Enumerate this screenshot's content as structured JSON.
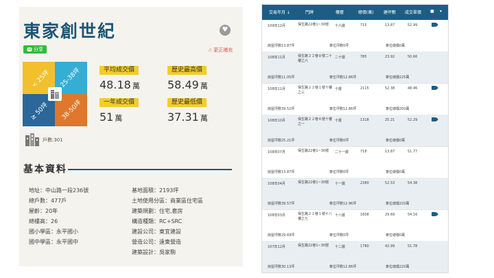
{
  "left": {
    "title": "東家創世紀",
    "favorite_icon": "heart-icon",
    "share_label": "分享",
    "share_icon_text": "LINE",
    "report_label": "更正補充",
    "area_grid": {
      "q1": "< 25坪",
      "q2": "25-38坪",
      "q3": "≥ 50坪",
      "q4": "38-50坪",
      "colors": {
        "q1": "#f2c02c",
        "q2": "#35aed6",
        "q3": "#2b6799",
        "q4": "#e0772a"
      }
    },
    "households": "戶數:301",
    "prices": [
      {
        "label": "平均成交價",
        "value": "48.18",
        "unit": "萬"
      },
      {
        "label": "歷史最高價",
        "value": "58.49",
        "unit": "萬"
      },
      {
        "label": "一年成交價",
        "value": "51",
        "unit": "萬"
      },
      {
        "label": "歷史最低價",
        "value": "37.31",
        "unit": "萬"
      }
    ],
    "basic_title": "基本資料",
    "info_left": [
      "地址：中山路一段236號",
      "總戶數：477戶",
      "屋齡：20年",
      "總樓高：26",
      "國小學區：永平國小",
      "國中學區：永平國中"
    ],
    "info_right": [
      "基地面積：2193坪",
      "土地使用分區：商業區住宅區",
      "建築規劃：住宅,套房",
      "構造種類：RC+SRC",
      "建設公司：東宜建設",
      "營造公司：遠東營造",
      "建築設計：吳家駒"
    ]
  },
  "table": {
    "headers": [
      "交易年月",
      "門牌",
      "樓層",
      "總價(萬)",
      "建坪數",
      "成交單價"
    ],
    "rows": [
      {
        "date": "109年12月",
        "addr": "保生路22巷1~30號",
        "floor": "十六層",
        "total": "715",
        "area": "13.87",
        "price": "52.99",
        "tag": true,
        "sub1": "房屋坪數13.87坪",
        "sub2": "車位坪數0坪",
        "sub3": "車位總價0萬"
      },
      {
        "date": "108年11月",
        "addr": "保生路２２巷８號二十樓之六",
        "floor": "二十層",
        "total": "785",
        "area": "23.92",
        "price": "50.66",
        "tag": false,
        "sub1": "房屋坪數11.05坪",
        "sub2": "車位坪數12.86坪",
        "sub3": "車位總價225萬"
      },
      {
        "date": "108年11月",
        "addr": "保生路２２巷１號十樓之三",
        "floor": "十層",
        "total": "2115",
        "area": "52.38",
        "price": "48.46",
        "tag": true,
        "sub1": "房屋坪數39.52坪",
        "sub2": "車位坪數12.86坪",
        "sub3": "車位總價200萬"
      },
      {
        "date": "108年10月",
        "addr": "保生路２２巷６號十樓之一",
        "floor": "十層",
        "total": "1318",
        "area": "25.21",
        "price": "52.29",
        "tag": true,
        "sub1": "房屋坪數25.21坪",
        "sub2": "車位坪數0坪",
        "sub3": "車位總價0萬"
      },
      {
        "date": "108年07月",
        "addr": "保生路22巷1~30號",
        "floor": "二十一層",
        "total": "718",
        "area": "13.87",
        "price": "51.77",
        "tag": false,
        "sub1": "房屋坪數13.87坪",
        "sub2": "車位坪數0坪",
        "sub3": "車位總價0萬"
      },
      {
        "date": "108年04月",
        "addr": "保生路22巷1~30號",
        "floor": "十一層",
        "total": "2380",
        "area": "52.53",
        "price": "54.38",
        "tag": false,
        "sub1": "房屋坪數39.57坪",
        "sub2": "車位坪數12.96坪",
        "sub3": "車位總價220萬"
      },
      {
        "date": "108年03月",
        "addr": "保生路２２巷１號十八樓之七",
        "floor": "十八層",
        "total": "1608",
        "area": "29.69",
        "price": "54.16",
        "tag": true,
        "sub1": "房屋坪數29.69坪",
        "sub2": "車位坪數0坪",
        "sub3": "車位總價0萬"
      },
      {
        "date": "107年12月",
        "addr": "保生路22巷1~30號",
        "floor": "十二層",
        "total": "1780",
        "area": "42.99",
        "price": "51.78",
        "tag": false,
        "sub1": "房屋坪數30.13坪",
        "sub2": "車位坪數12.86坪",
        "sub3": "車位總價220萬"
      }
    ]
  }
}
